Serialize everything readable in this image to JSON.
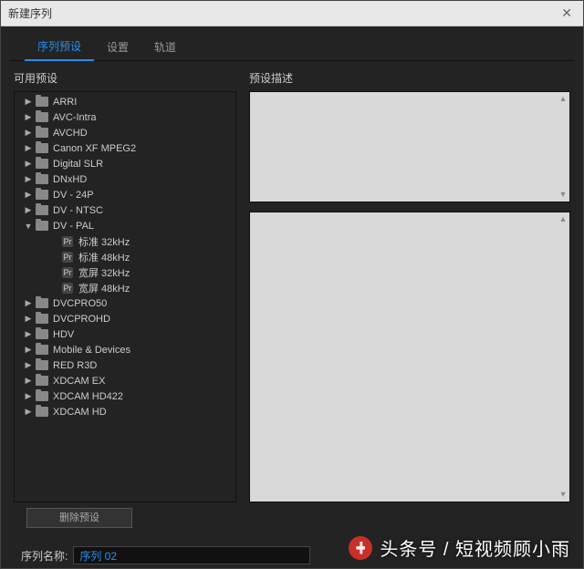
{
  "window": {
    "title": "新建序列"
  },
  "tabs": [
    {
      "label": "序列预设",
      "active": true
    },
    {
      "label": "设置",
      "active": false
    },
    {
      "label": "轨道",
      "active": false
    }
  ],
  "leftLabel": "可用预设",
  "rightLabel": "预设描述",
  "tree": [
    {
      "kind": "folder",
      "label": "ARRI",
      "depth": 0,
      "arrow": "right"
    },
    {
      "kind": "folder",
      "label": "AVC-Intra",
      "depth": 0,
      "arrow": "right"
    },
    {
      "kind": "folder",
      "label": "AVCHD",
      "depth": 0,
      "arrow": "right"
    },
    {
      "kind": "folder",
      "label": "Canon XF MPEG2",
      "depth": 0,
      "arrow": "right"
    },
    {
      "kind": "folder",
      "label": "Digital SLR",
      "depth": 0,
      "arrow": "right"
    },
    {
      "kind": "folder",
      "label": "DNxHD",
      "depth": 0,
      "arrow": "right"
    },
    {
      "kind": "folder",
      "label": "DV - 24P",
      "depth": 0,
      "arrow": "right"
    },
    {
      "kind": "folder",
      "label": "DV - NTSC",
      "depth": 0,
      "arrow": "right"
    },
    {
      "kind": "folder",
      "label": "DV - PAL",
      "depth": 0,
      "arrow": "down"
    },
    {
      "kind": "preset",
      "label": "标准 32kHz",
      "depth": 1
    },
    {
      "kind": "preset",
      "label": "标准 48kHz",
      "depth": 1
    },
    {
      "kind": "preset",
      "label": "宽屏 32kHz",
      "depth": 1
    },
    {
      "kind": "preset",
      "label": "宽屏 48kHz",
      "depth": 1
    },
    {
      "kind": "folder",
      "label": "DVCPRO50",
      "depth": 0,
      "arrow": "right"
    },
    {
      "kind": "folder",
      "label": "DVCPROHD",
      "depth": 0,
      "arrow": "right"
    },
    {
      "kind": "folder",
      "label": "HDV",
      "depth": 0,
      "arrow": "right"
    },
    {
      "kind": "folder",
      "label": "Mobile & Devices",
      "depth": 0,
      "arrow": "right"
    },
    {
      "kind": "folder",
      "label": "RED R3D",
      "depth": 0,
      "arrow": "right"
    },
    {
      "kind": "folder",
      "label": "XDCAM EX",
      "depth": 0,
      "arrow": "right"
    },
    {
      "kind": "folder",
      "label": "XDCAM HD422",
      "depth": 0,
      "arrow": "right"
    },
    {
      "kind": "folder",
      "label": "XDCAM HD",
      "depth": 0,
      "arrow": "right"
    }
  ],
  "deleteBtn": "删除预设",
  "seqNameLabel": "序列名称:",
  "seqNameValue": "序列 02",
  "watermark": "头条号 / 短视频顾小雨"
}
